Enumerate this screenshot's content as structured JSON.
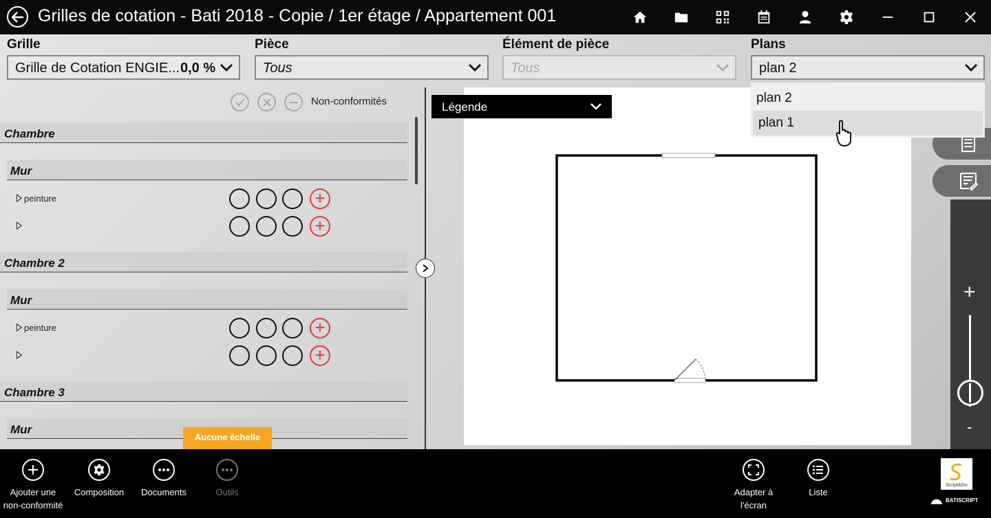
{
  "titlebar": {
    "title": "Grilles de cotation - Bati 2018 - Copie / 1er étage / Appartement 001",
    "icons": [
      "back-icon",
      "home-icon",
      "folder-icon",
      "qr-code-icon",
      "calendar-icon",
      "user-icon",
      "gear-icon",
      "minimize-icon",
      "maximize-icon",
      "close-icon"
    ]
  },
  "filters": {
    "grille": {
      "label": "Grille",
      "value": "Grille de Cotation ENGIE...",
      "percent": "0,0 %"
    },
    "piece": {
      "label": "Pièce",
      "value": "Tous"
    },
    "element": {
      "label": "Élément de pièce",
      "value": "Tous"
    },
    "plans": {
      "label": "Plans",
      "value": "plan 2",
      "options": [
        "plan 2",
        "plan 1"
      ]
    }
  },
  "left_panel": {
    "nonconf_label": "Non-conformités",
    "sections": [
      {
        "title": "Chambre",
        "sub": "Mur",
        "items": [
          "peinture",
          ""
        ]
      },
      {
        "title": "Chambre 2",
        "sub": "Mur",
        "items": [
          "peinture",
          ""
        ]
      },
      {
        "title": "Chambre 3",
        "sub": "Mur",
        "items": []
      }
    ],
    "scale_badge": "Aucune échelle"
  },
  "legend": {
    "label": "Légende"
  },
  "zoom": {
    "plus": "+",
    "minus": "-"
  },
  "bottombar": {
    "add_nc": "Ajouter une non-conformité",
    "composition": "Composition",
    "documents": "Documents",
    "outils": "Outils",
    "fit_screen": "Adapter à l'écran",
    "liste": "Liste",
    "brand": "BATISCRIPT",
    "logo_text": "Script&Go"
  },
  "colors": {
    "accent_orange": "#f6a623",
    "plus_red": "#e53935"
  }
}
